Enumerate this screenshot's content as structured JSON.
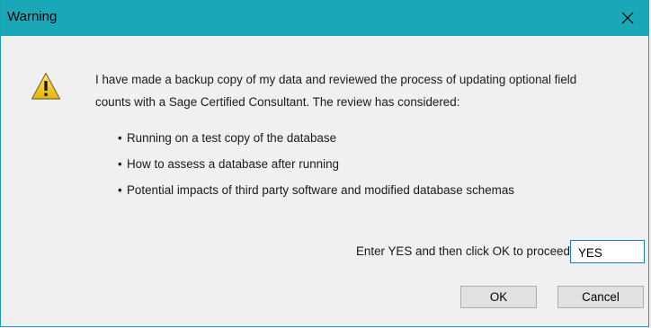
{
  "window": {
    "title": "Warning"
  },
  "icons": {
    "close": "close-icon",
    "warning": "warning-icon"
  },
  "colors": {
    "titlebar": "#1aa8b8",
    "warning_fill": "#f5d21e",
    "input_border": "#1b79c8"
  },
  "message": {
    "line1": "I have made a backup copy of my data and reviewed the process of updating optional field",
    "line2": "counts with a Sage Certified Consultant. The review has considered:"
  },
  "bullets": [
    "Running on a test copy of the database",
    "How to assess a database after running",
    "Potential impacts of third party software and modified database schemas"
  ],
  "confirm": {
    "label": "Enter YES and then click OK to proceed",
    "value": "YES"
  },
  "buttons": {
    "ok": "OK",
    "cancel": "Cancel"
  }
}
